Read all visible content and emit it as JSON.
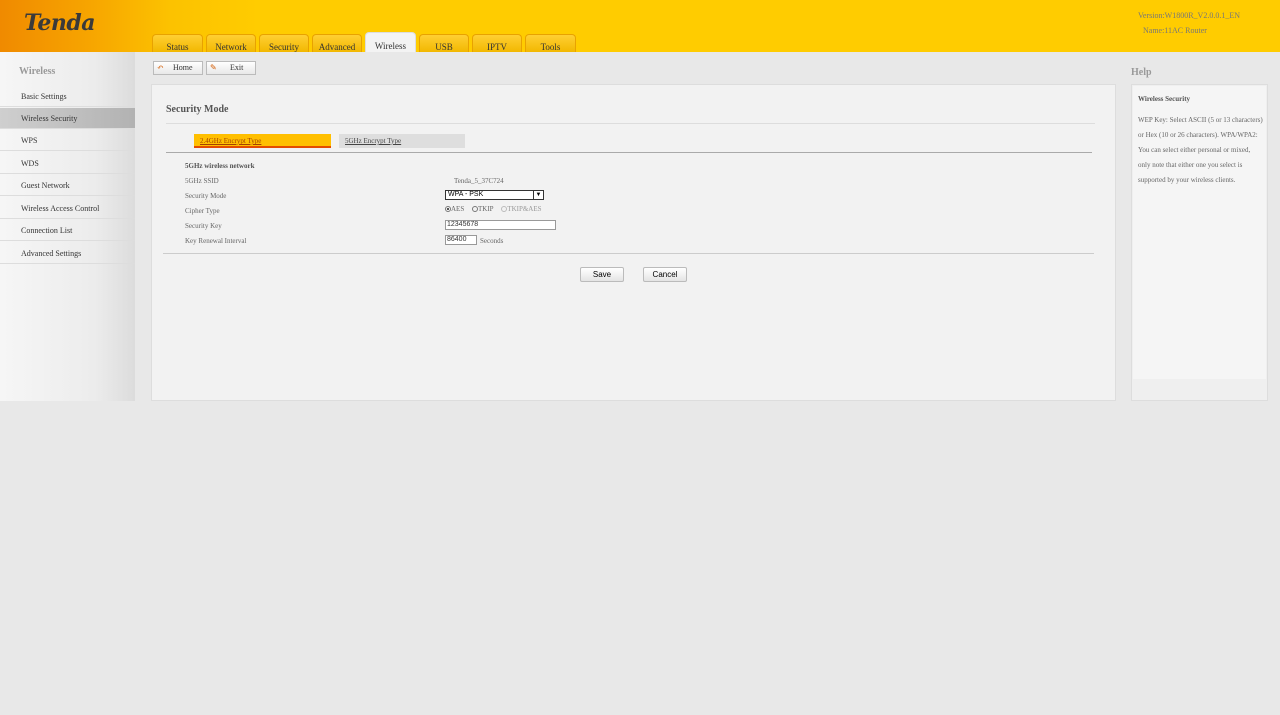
{
  "header": {
    "logo": "Tenda",
    "version": "Version:W1800R_V2.0.0.1_EN",
    "name": "Name:11AC Router",
    "tabs": [
      "Status",
      "Network",
      "Security",
      "Advanced",
      "Wireless",
      "USB",
      "IPTV",
      "Tools"
    ],
    "active_tab": "Wireless"
  },
  "sidebar": {
    "title": "Wireless",
    "items": [
      "Basic Settings",
      "Wireless Security",
      "WPS",
      "WDS",
      "Guest Network",
      "Wireless Access Control",
      "Connection List",
      "Advanced Settings"
    ],
    "active_item": "Wireless Security"
  },
  "toolbar": {
    "home": "Home",
    "exit": "Exit"
  },
  "main": {
    "title": "Security Mode",
    "subtabs": [
      "2.4GHz Encrypt Type",
      "5GHz Encrypt Type"
    ],
    "section": "5GHz wireless network",
    "labels": {
      "ssid": "5GHz SSID",
      "mode": "Security Mode",
      "cipher": "Cipher Type",
      "key": "Security Key",
      "interval": "Key Renewal Interval"
    },
    "values": {
      "ssid": "Tenda_5_37C724",
      "mode": "WPA - PSK",
      "key": "12345678",
      "interval": "86400",
      "interval_unit": "Seconds"
    },
    "cipher_options": [
      "AES",
      "TKIP",
      "TKIP&AES"
    ],
    "cipher_selected": "AES",
    "save": "Save",
    "cancel": "Cancel"
  },
  "help": {
    "title": "Help",
    "heading": "Wireless Security",
    "text": "WEP Key: Select ASCII (5 or 13 characters) or Hex (10 or 26 characters). WPA/WPA2: You can select either personal or mixed, only note that either one you select is supported by your wireless clients."
  },
  "colors": {
    "header_yellow": "#ffcc00",
    "header_orange": "#f08a00",
    "subtab_active": "#ffbf00",
    "subtab_underline": "#e44c00"
  }
}
